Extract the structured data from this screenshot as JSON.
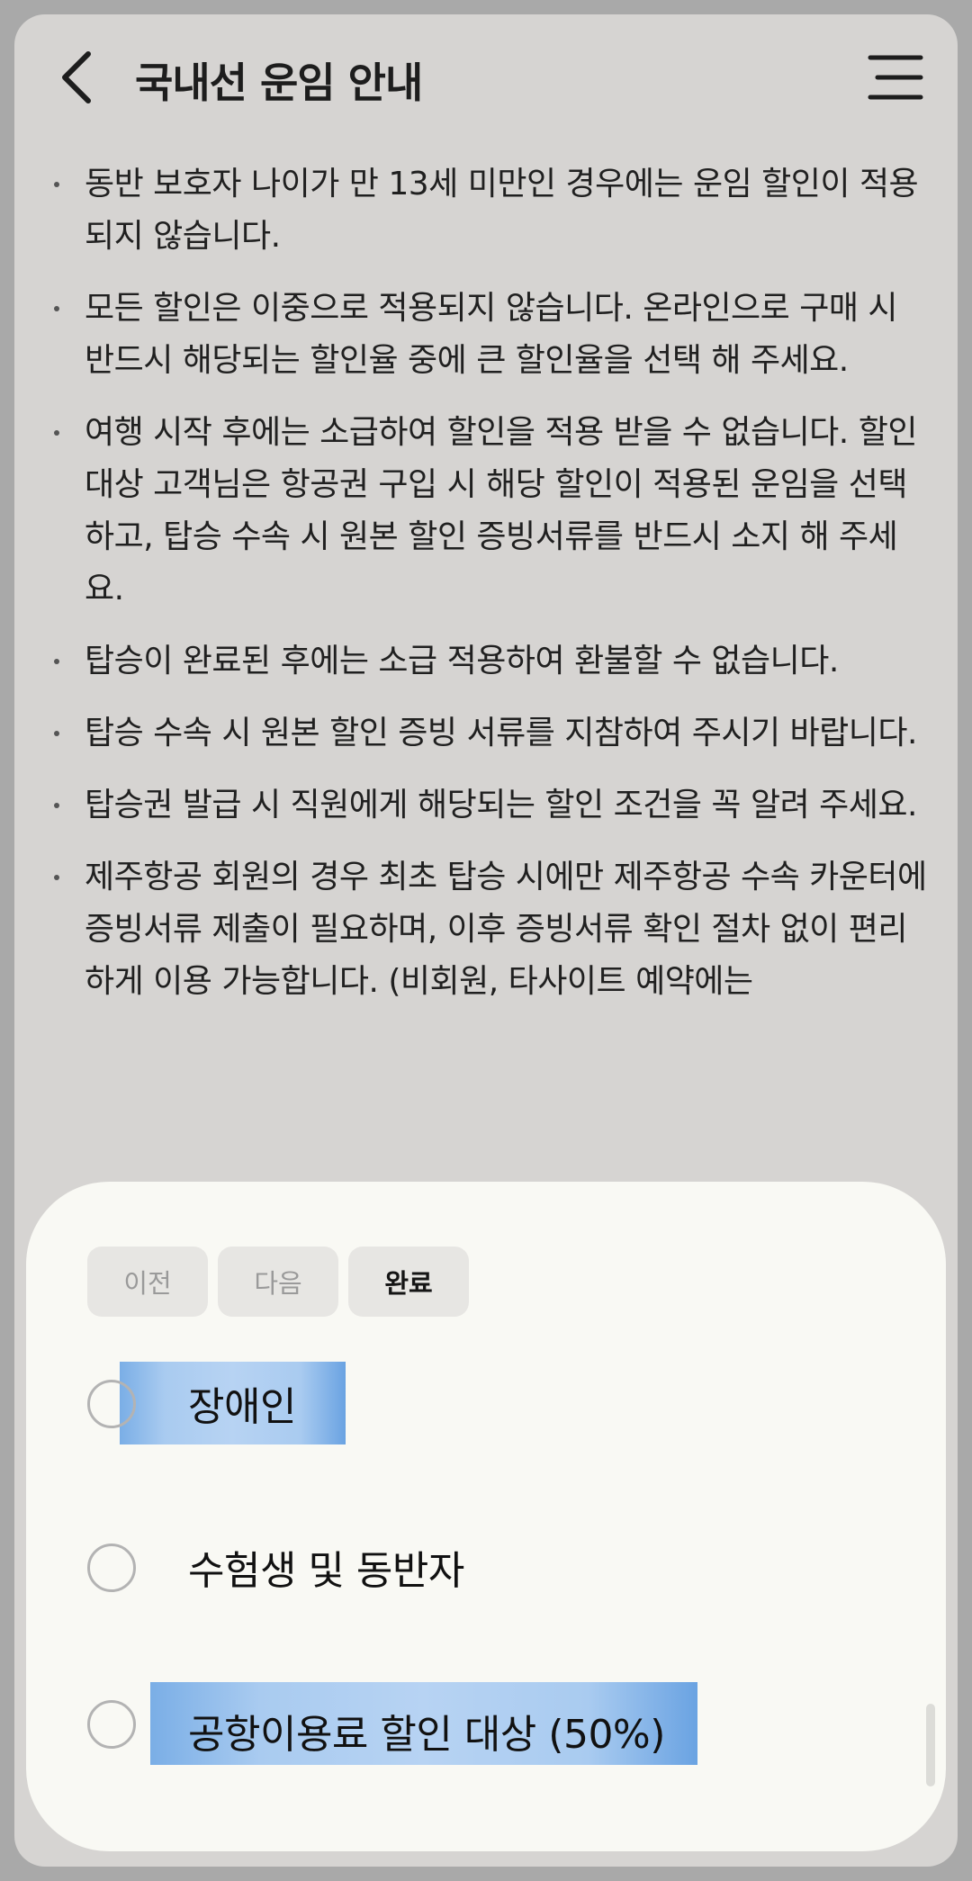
{
  "header": {
    "title": "국내선 운임 안내",
    "back_icon": "chevron-left-icon",
    "menu_icon": "hamburger-menu-icon"
  },
  "notices": [
    "동반 보호자 나이가 만 13세 미만인 경우에는 운임 할인이 적용되지 않습니다.",
    "모든 할인은 이중으로 적용되지 않습니다. 온라인으로 구매 시 반드시 해당되는 할인율 중에 큰 할인율을 선택 해 주세요.",
    "여행 시작 후에는 소급하여 할인을 적용 받을 수 없습니다. 할인 대상 고객님은 항공권 구입 시 해당 할인이 적용된 운임을 선택하고, 탑승 수속 시 원본 할인 증빙서류를 반드시 소지 해 주세요.",
    "탑승이 완료된 후에는 소급 적용하여 환불할 수 없습니다.",
    "탑승 수속 시 원본 할인 증빙 서류를 지참하여 주시기 바랍니다.",
    "탑승권 발급 시 직원에게 해당되는 할인 조건을 꼭 알려 주세요.",
    "제주항공 회원의 경우 최초 탑승 시에만 제주항공 수속 카운터에 증빙서류 제출이 필요하며, 이후 증빙서류 확인 절차 없이 편리하게 이용 가능합니다. (비회원, 타사이트 예약에는"
  ],
  "sheet": {
    "prev_label": "이전",
    "next_label": "다음",
    "done_label": "완료",
    "options": [
      {
        "label": "장애인",
        "selected": false
      },
      {
        "label": "수험생 및 동반자",
        "selected": false
      },
      {
        "label": "공항이용료 할인 대상 (50%)",
        "selected": false
      }
    ]
  },
  "colors": {
    "background": "#d6d4d2",
    "sheet": "#f9f9f4",
    "highlight": "#a9cbf0",
    "text": "#202020"
  }
}
